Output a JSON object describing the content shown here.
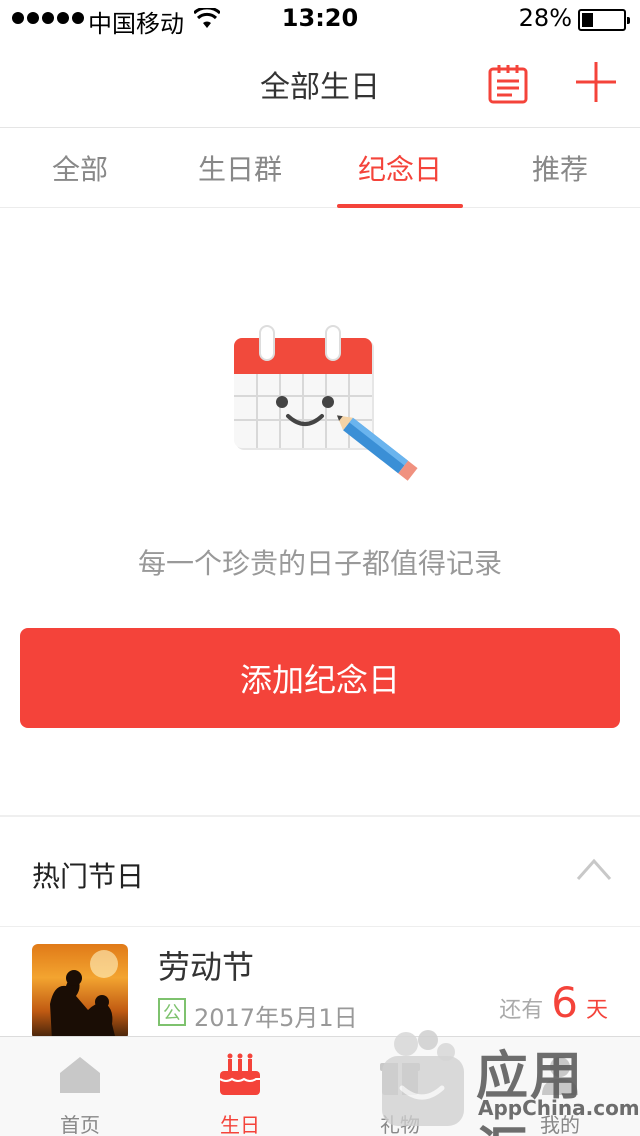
{
  "status_bar": {
    "carrier": "中国移动",
    "time": "13:20",
    "battery_percent": "28%",
    "battery_level": 0.28
  },
  "nav": {
    "title": "全部生日",
    "calendar_icon": "calendar-list-icon",
    "add_icon": "plus-icon",
    "accent_color": "#f4433a"
  },
  "tabs": [
    {
      "label": "全部",
      "active": false
    },
    {
      "label": "生日群",
      "active": false
    },
    {
      "label": "纪念日",
      "active": true
    },
    {
      "label": "推荐",
      "active": false
    }
  ],
  "empty_state": {
    "illustration": "smiling-calendar-with-pencil-icon",
    "message": "每一个珍贵的日子都值得记录",
    "button_label": "添加纪念日"
  },
  "popular": {
    "title": "热门节日",
    "collapse_icon": "chevron-up-icon",
    "items": [
      {
        "name": "劳动节",
        "badge": "公",
        "date": "2017年5月1日",
        "countdown_prefix": "还有",
        "countdown_days": "6",
        "countdown_unit": "天"
      }
    ]
  },
  "tab_bar": [
    {
      "label": "首页",
      "icon": "home-icon",
      "active": false
    },
    {
      "label": "生日",
      "icon": "birthday-cake-icon",
      "active": true
    },
    {
      "label": "礼物",
      "icon": "gift-icon",
      "active": false
    },
    {
      "label": "我的",
      "icon": "profile-icon",
      "active": false
    }
  ],
  "watermark": {
    "title": "应用汇",
    "subtitle": "AppChina.com"
  }
}
